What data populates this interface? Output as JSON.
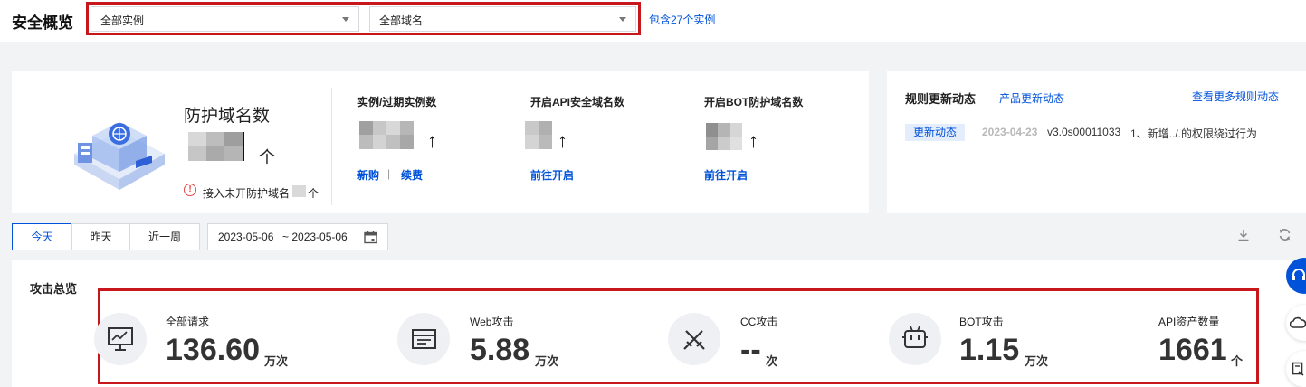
{
  "header": {
    "title": "安全概览",
    "instance_select": "全部实例",
    "domain_select": "全部域名",
    "instance_count_link": "包含27个实例"
  },
  "domain_card": {
    "title": "防护域名数",
    "unit": "个",
    "warning_text": "接入未开防护域名",
    "warning_unit": "个",
    "instance_label": "实例/过期实例数",
    "buy_link": "新购",
    "separator": "|",
    "renew_link": "续费",
    "api_label": "开启API安全域名数",
    "api_link": "前往开启",
    "bot_label": "开启BOT防护域名数",
    "bot_link": "前往开启",
    "up_arrow": "↑"
  },
  "rules_card": {
    "title": "规则更新动态",
    "product_link": "产品更新动态",
    "more_link": "查看更多规则动态",
    "tag": "更新动态",
    "date": "2023-04-23",
    "version": "v3.0s00011033",
    "content": "1、新增../.的权限绕过行为"
  },
  "filters": {
    "today": "今天",
    "yesterday": "昨天",
    "week": "近一周",
    "start_date": "2023-05-06",
    "end_date": "~ 2023-05-06"
  },
  "attack_overview": {
    "title": "攻击总览",
    "stats": [
      {
        "label": "全部请求",
        "value": "136.60",
        "unit": "万次"
      },
      {
        "label": "Web攻击",
        "value": "5.88",
        "unit": "万次"
      },
      {
        "label": "CC攻击",
        "value": "--",
        "unit": "次"
      },
      {
        "label": "BOT攻击",
        "value": "1.15",
        "unit": "万次"
      },
      {
        "label": "API资产数量",
        "value": "1661",
        "unit": "个"
      }
    ]
  },
  "colors": {
    "accent": "#0052d9",
    "highlight_red": "#c8161d",
    "warning_red": "#e54545"
  }
}
